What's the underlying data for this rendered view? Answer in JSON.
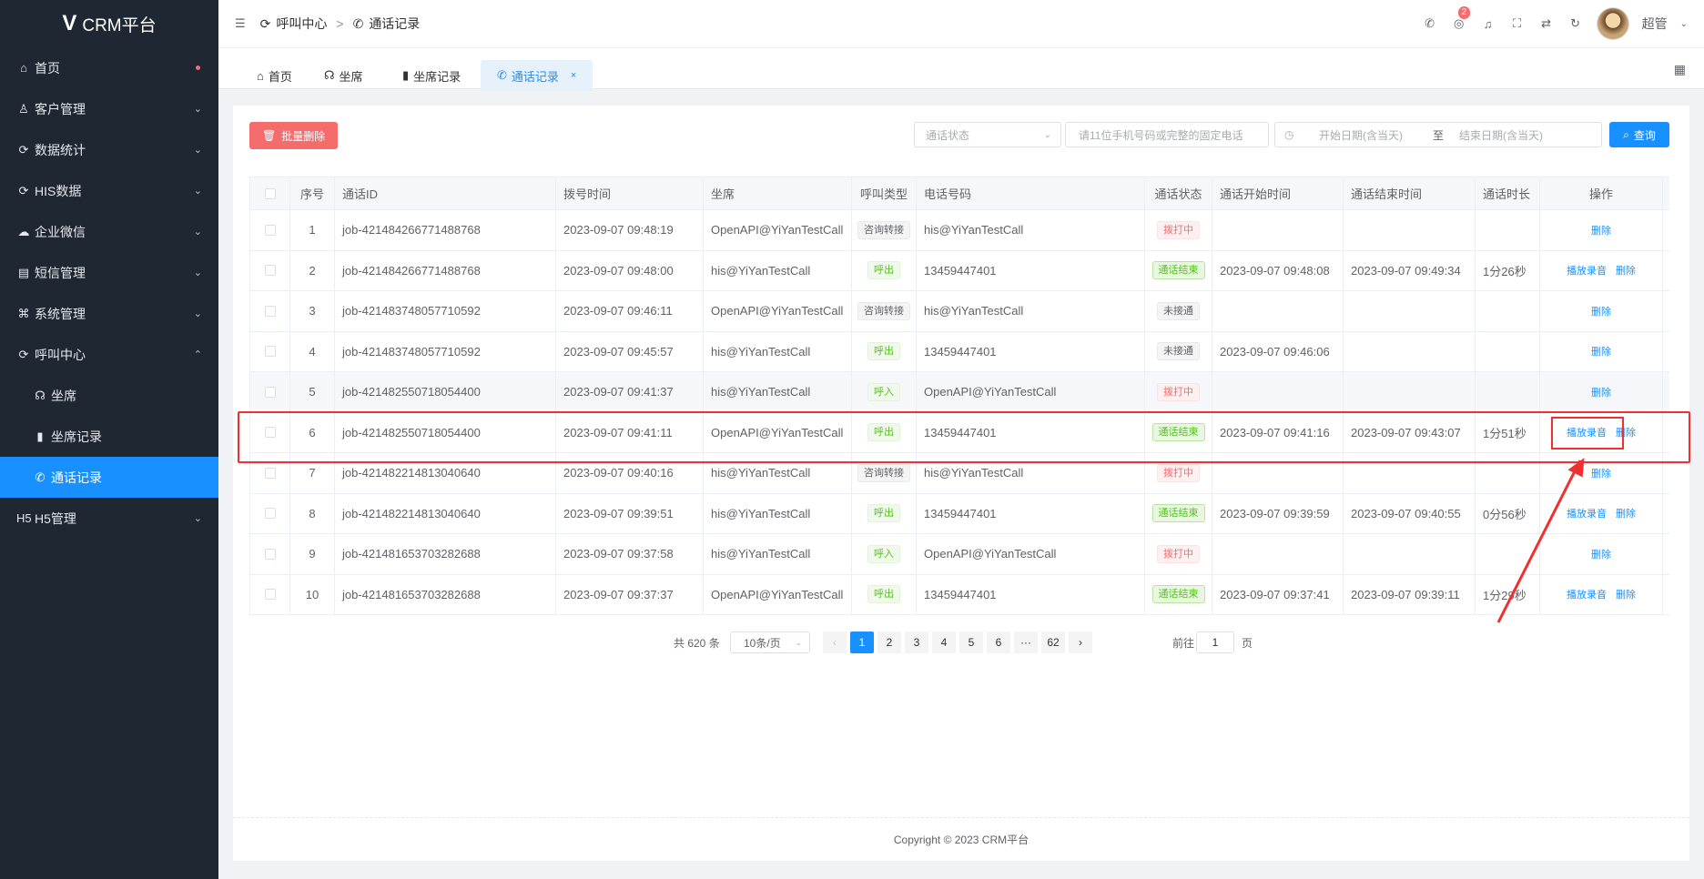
{
  "sidebar": {
    "logo": "CRM平台",
    "items": [
      {
        "icon": "⌂",
        "label": "首页",
        "dot": true
      },
      {
        "icon": "♙",
        "label": "客户管理",
        "chev": "⌄"
      },
      {
        "icon": "⟳",
        "label": "数据统计",
        "chev": "⌄"
      },
      {
        "icon": "⟳",
        "label": "HIS数据",
        "chev": "⌄"
      },
      {
        "icon": "☁",
        "label": "企业微信",
        "chev": "⌄"
      },
      {
        "icon": "▤",
        "label": "短信管理",
        "chev": "⌄"
      },
      {
        "icon": "⌘",
        "label": "系统管理",
        "chev": "⌄"
      },
      {
        "icon": "⟳",
        "label": "呼叫中心",
        "chev": "⌃"
      }
    ],
    "submenu": [
      {
        "icon": "☊",
        "label": "坐席"
      },
      {
        "icon": "▮",
        "label": "坐席记录"
      },
      {
        "icon": "✆",
        "label": "通话记录"
      }
    ],
    "last": {
      "icon": "H5",
      "label": "H5管理",
      "chev": "⌄"
    }
  },
  "header": {
    "breadcrumb": [
      "呼叫中心",
      "通话记录"
    ],
    "badge": "2",
    "user": "超管"
  },
  "tabs": [
    "首页",
    "坐席",
    "坐席记录",
    "通话记录"
  ],
  "toolbar": {
    "batch_delete": "批量删除",
    "status_placeholder": "通话状态",
    "phone_placeholder": "请11位手机号码或完整的固定电话",
    "start_placeholder": "开始日期(含当天)",
    "to": "至",
    "end_placeholder": "结束日期(含当天)",
    "search": "查询"
  },
  "table": {
    "columns": [
      "序号",
      "通话ID",
      "拨号时间",
      "坐席",
      "呼叫类型",
      "电话号码",
      "通话状态",
      "通话开始时间",
      "通话结束时间",
      "通话时长",
      "操作"
    ],
    "rows": [
      {
        "no": "1",
        "id": "job-421484266771488768",
        "dial": "2023-09-07 09:48:19",
        "agent": "OpenAPI@YiYanTestCall",
        "type": "咨询转接",
        "typeStyle": "info",
        "phone": "his@YiYanTestCall",
        "status": "拨打中",
        "statusStyle": "danger",
        "start": "",
        "end": "",
        "dur": "",
        "play": "",
        "del": "删除"
      },
      {
        "no": "2",
        "id": "job-421484266771488768",
        "dial": "2023-09-07 09:48:00",
        "agent": "his@YiYanTestCall",
        "type": "呼出",
        "typeStyle": "success",
        "phone": "13459447401",
        "status": "通话结束",
        "statusStyle": "success-solid",
        "start": "2023-09-07 09:48:08",
        "end": "2023-09-07 09:49:34",
        "dur": "1分26秒",
        "play": "播放录音",
        "del": "删除"
      },
      {
        "no": "3",
        "id": "job-421483748057710592",
        "dial": "2023-09-07 09:46:11",
        "agent": "OpenAPI@YiYanTestCall",
        "type": "咨询转接",
        "typeStyle": "info",
        "phone": "his@YiYanTestCall",
        "status": "未接通",
        "statusStyle": "info",
        "start": "",
        "end": "",
        "dur": "",
        "play": "",
        "del": "删除"
      },
      {
        "no": "4",
        "id": "job-421483748057710592",
        "dial": "2023-09-07 09:45:57",
        "agent": "his@YiYanTestCall",
        "type": "呼出",
        "typeStyle": "success",
        "phone": "13459447401",
        "status": "未接通",
        "statusStyle": "info",
        "start": "2023-09-07 09:46:06",
        "end": "",
        "dur": "",
        "play": "",
        "del": "删除"
      },
      {
        "no": "5",
        "id": "job-421482550718054400",
        "dial": "2023-09-07 09:41:37",
        "agent": "his@YiYanTestCall",
        "type": "呼入",
        "typeStyle": "success",
        "phone": "OpenAPI@YiYanTestCall",
        "status": "拨打中",
        "statusStyle": "danger",
        "start": "",
        "end": "",
        "dur": "",
        "play": "",
        "del": "删除"
      },
      {
        "no": "6",
        "id": "job-421482550718054400",
        "dial": "2023-09-07 09:41:11",
        "agent": "OpenAPI@YiYanTestCall",
        "type": "呼出",
        "typeStyle": "success",
        "phone": "13459447401",
        "status": "通话结束",
        "statusStyle": "success-solid",
        "start": "2023-09-07 09:41:16",
        "end": "2023-09-07 09:43:07",
        "dur": "1分51秒",
        "play": "播放录音",
        "del": "删除"
      },
      {
        "no": "7",
        "id": "job-421482214813040640",
        "dial": "2023-09-07 09:40:16",
        "agent": "his@YiYanTestCall",
        "type": "咨询转接",
        "typeStyle": "info",
        "phone": "his@YiYanTestCall",
        "status": "拨打中",
        "statusStyle": "danger",
        "start": "",
        "end": "",
        "dur": "",
        "play": "",
        "del": "删除"
      },
      {
        "no": "8",
        "id": "job-421482214813040640",
        "dial": "2023-09-07 09:39:51",
        "agent": "his@YiYanTestCall",
        "type": "呼出",
        "typeStyle": "success",
        "phone": "13459447401",
        "status": "通话结束",
        "statusStyle": "success-solid",
        "start": "2023-09-07 09:39:59",
        "end": "2023-09-07 09:40:55",
        "dur": "0分56秒",
        "play": "播放录音",
        "del": "删除"
      },
      {
        "no": "9",
        "id": "job-421481653703282688",
        "dial": "2023-09-07 09:37:58",
        "agent": "his@YiYanTestCall",
        "type": "呼入",
        "typeStyle": "success",
        "phone": "OpenAPI@YiYanTestCall",
        "status": "拨打中",
        "statusStyle": "danger",
        "start": "",
        "end": "",
        "dur": "",
        "play": "",
        "del": "删除"
      },
      {
        "no": "10",
        "id": "job-421481653703282688",
        "dial": "2023-09-07 09:37:37",
        "agent": "OpenAPI@YiYanTestCall",
        "type": "呼出",
        "typeStyle": "success",
        "phone": "13459447401",
        "status": "通话结束",
        "statusStyle": "success-solid",
        "start": "2023-09-07 09:37:41",
        "end": "2023-09-07 09:39:11",
        "dur": "1分29秒",
        "play": "播放录音",
        "del": "删除"
      }
    ]
  },
  "pagination": {
    "total": "共 620 条",
    "size": "10条/页",
    "pages": [
      "1",
      "2",
      "3",
      "4",
      "5",
      "6",
      "···",
      "62"
    ],
    "current": "1",
    "goto": "前往",
    "goto_value": "1",
    "page_suffix": "页"
  },
  "footer": "Copyright © 2023 CRM平台"
}
